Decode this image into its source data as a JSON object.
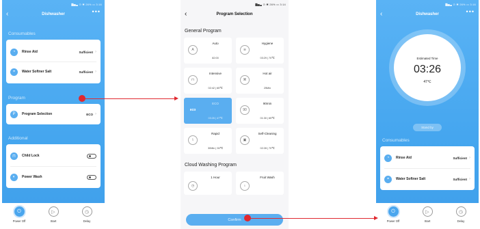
{
  "screen1": {
    "status": "▇▅▃ ⊙ ✱ 26% ▭ 3:16",
    "title": "Dishwasher",
    "more": "•••",
    "consumables_label": "Consumables",
    "rinse_aid": {
      "label": "Rinse Aid",
      "value": "Sufficient"
    },
    "softener": {
      "label": "Water Softner Salt",
      "value": "Sufficient"
    },
    "program_label": "Program",
    "program_selection": {
      "label": "Program Selection",
      "value": "ECO"
    },
    "additional_label": "Additional",
    "child_lock": {
      "label": "Child Lock"
    },
    "power_wash": {
      "label": "Power Wash"
    },
    "bottom": {
      "power": "Power Off",
      "start": "Start",
      "delay": "Delay"
    }
  },
  "screen2": {
    "status": "▇▅▃ ⊙ ✱ 26% ▭ 3:14",
    "title": "Program Selection",
    "general_label": "General Program",
    "programs": [
      {
        "name": "Auto",
        "info": "82:00",
        "icon": "A"
      },
      {
        "name": "Hygiene",
        "info": "03:29 | 70℃",
        "icon": "≋"
      },
      {
        "name": "Intensive",
        "info": "02:42 | 65℃",
        "icon": "⊓"
      },
      {
        "name": "Hot air",
        "info": "25Min",
        "icon": "⌘"
      },
      {
        "name": "ECO",
        "info": "03:26 | 47℃",
        "icon": "eco"
      },
      {
        "name": "90min",
        "info": "01:30 | 65℃",
        "icon": "90"
      },
      {
        "name": "Rapid",
        "info": "30Min | 50℃",
        "icon": "⌇"
      },
      {
        "name": "Self-Cleaning",
        "info": "02:28 | 70℃",
        "icon": "▣"
      }
    ],
    "cloud_label": "Cloud Washing Program",
    "cloud_programs": [
      {
        "name": "1 Hour",
        "icon": "◷"
      },
      {
        "name": "Fruit Wash",
        "icon": "♁"
      }
    ],
    "confirm": "Confirm"
  },
  "screen3": {
    "status": "▇▅▃ ⊙ ✱ 26% ▭ 3:16",
    "title": "Dishwasher",
    "more": "•••",
    "estimated_label": "Estimated Time",
    "time": "03:26",
    "temp": "47℃",
    "standby": "Stand by",
    "consumables_label": "Consumables",
    "rinse_aid": {
      "label": "Rinse Aid",
      "value": "Sufficient"
    },
    "softener": {
      "label": "Water Softner Salt",
      "value": "Sufficient"
    },
    "bottom": {
      "power": "Power Off",
      "start": "Start",
      "delay": "Delay"
    }
  }
}
